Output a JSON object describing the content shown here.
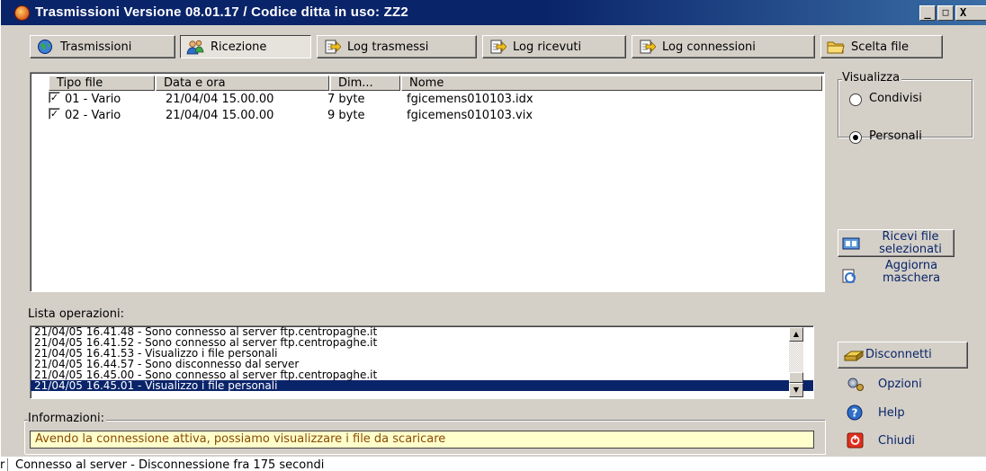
{
  "window": {
    "title": "Trasmissioni Versione 08.01.17 / Codice ditta in uso: ZZ2",
    "controls": [
      "_",
      "□",
      "X"
    ]
  },
  "tabs": [
    {
      "label": "Trasmissioni",
      "icon": "globe-icon",
      "active": false
    },
    {
      "label": "Ricezione",
      "icon": "people-icon",
      "active": true
    },
    {
      "label": "Log trasmessi",
      "icon": "log-arrow-icon",
      "active": false
    },
    {
      "label": "Log ricevuti",
      "icon": "log-arrow-icon",
      "active": false
    },
    {
      "label": "Log connessioni",
      "icon": "log-arrow-icon",
      "active": false
    },
    {
      "label": "Scelta file",
      "icon": "folder-icon",
      "active": false
    }
  ],
  "file_list": {
    "columns": [
      "Tipo file",
      "Data e ora",
      "Dim...",
      "Nome"
    ],
    "rows": [
      {
        "checked": true,
        "tipo": "01 - Vario",
        "data": "21/04/04 15.00.00",
        "dim": "7 byte",
        "nome": "fgicemens010103.idx"
      },
      {
        "checked": true,
        "tipo": "02 - Vario",
        "data": "21/04/04 15.00.00",
        "dim": "9 byte",
        "nome": "fgicemens010103.vix"
      }
    ]
  },
  "visualizza": {
    "label": "Visualizza",
    "options": [
      {
        "label": "Condivisi",
        "selected": false
      },
      {
        "label": "Personali",
        "selected": true
      }
    ]
  },
  "side_buttons": {
    "ricevi_line1": "Ricevi file",
    "ricevi_line2": "selezionati",
    "aggiorna_line1": "Aggiorna",
    "aggiorna_line2": "maschera",
    "disconnetti": "Disconnetti",
    "opzioni": "Opzioni",
    "help": "Help",
    "chiudi": "Chiudi"
  },
  "operations": {
    "label": "Lista operazioni:",
    "items": [
      "21/04/05 16.41.48 - Sono connesso al server ftp.centropaghe.it",
      "21/04/05 16.41.52 - Sono connesso al server ftp.centropaghe.it",
      "21/04/05 16.41.53 - Visualizzo i file personali",
      "21/04/05 16.44.57 - Sono disconnesso dal server",
      "21/04/05 16.45.00 - Sono connesso al server ftp.centropaghe.it",
      "21/04/05 16.45.01 - Visualizzo i file personali"
    ],
    "selected_index": 5
  },
  "info": {
    "label": "Informazioni:",
    "text": "Avendo la connessione attiva, possiamo visualizzare i file da scaricare"
  },
  "status": {
    "prefix": "r",
    "text": "Connesso al server - Disconnessione fra 175 secondi"
  },
  "colors": {
    "title_bar": "#0a246a",
    "selection": "#0a246a",
    "info_background": "#ffffcc",
    "face": "#d4d0c8"
  }
}
